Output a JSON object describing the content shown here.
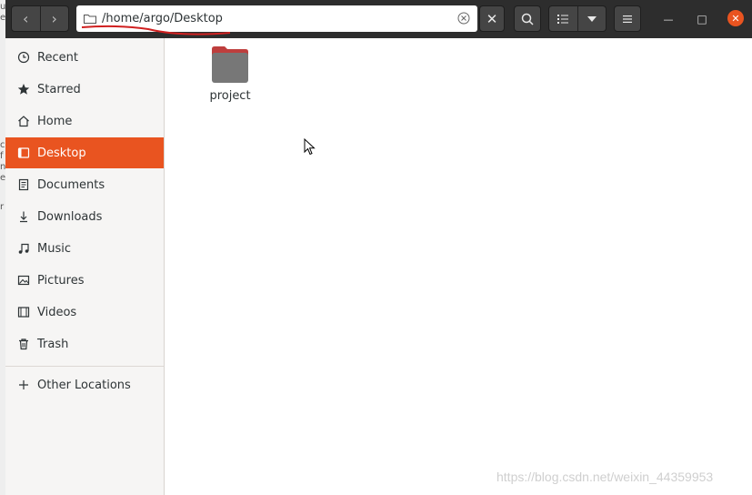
{
  "background_strip": [
    "u",
    "e",
    "c",
    "f",
    "n",
    "e",
    "r"
  ],
  "header": {
    "back_glyph": "‹",
    "forward_glyph": "›",
    "path": "/home/argo/Desktop",
    "close_glyph": "✕",
    "minimize_glyph": "—",
    "maximize_glyph": "□",
    "window_close_glyph": "✕"
  },
  "sidebar": {
    "items": [
      {
        "label": "Recent",
        "icon": "clock-icon"
      },
      {
        "label": "Starred",
        "icon": "star-icon"
      },
      {
        "label": "Home",
        "icon": "home-icon"
      },
      {
        "label": "Desktop",
        "icon": "desktop-icon",
        "active": true
      },
      {
        "label": "Documents",
        "icon": "document-icon"
      },
      {
        "label": "Downloads",
        "icon": "download-icon"
      },
      {
        "label": "Music",
        "icon": "music-icon"
      },
      {
        "label": "Pictures",
        "icon": "picture-icon"
      },
      {
        "label": "Videos",
        "icon": "video-icon"
      },
      {
        "label": "Trash",
        "icon": "trash-icon"
      }
    ],
    "other_locations": {
      "label": "Other Locations",
      "icon": "plus-icon"
    }
  },
  "files": [
    {
      "name": "project",
      "type": "folder"
    }
  ],
  "watermark": "https://blog.csdn.net/weixin_44359953",
  "colors": {
    "accent": "#e95420",
    "header": "#2d2d2d",
    "folder": "#7a7a7a",
    "folder_tab": "#e95420"
  }
}
